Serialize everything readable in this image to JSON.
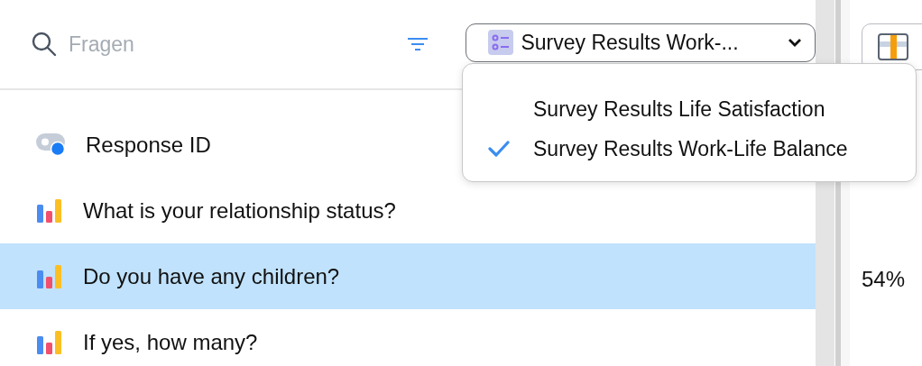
{
  "search": {
    "placeholder": "Fragen"
  },
  "dataset_select": {
    "value": "Survey Results Work-...",
    "expanded": true,
    "options": [
      {
        "label": "Survey Results Life Satisfaction",
        "selected": false
      },
      {
        "label": "Survey Results Work-Life Balance",
        "selected": true
      }
    ]
  },
  "questions": [
    {
      "kind": "id",
      "label": "Response ID",
      "selected": false
    },
    {
      "kind": "chart",
      "label": "What is your relationship status?",
      "selected": false
    },
    {
      "kind": "chart",
      "label": "Do you have any children?",
      "selected": true
    },
    {
      "kind": "chart",
      "label": "If yes, how many?",
      "selected": false
    }
  ],
  "percentages": [
    "54%"
  ]
}
